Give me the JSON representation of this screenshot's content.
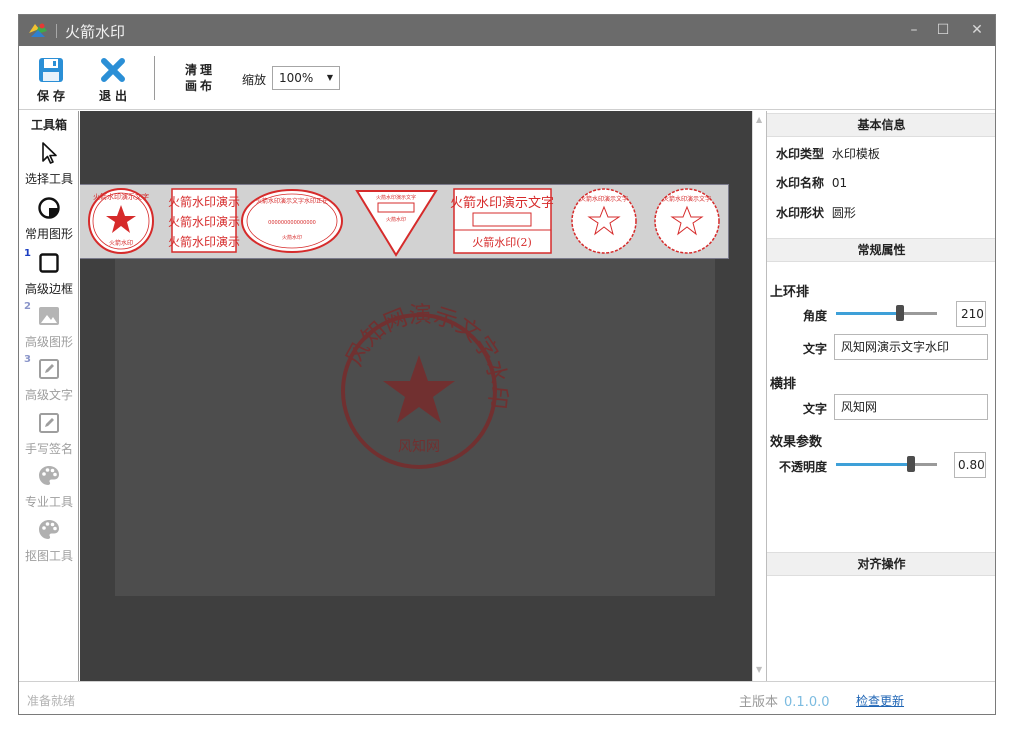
{
  "window": {
    "title": "火箭水印",
    "minimize": "–",
    "maximize": "☐",
    "close": "✕"
  },
  "toolbar": {
    "save_label": "保存",
    "exit_label": "退出",
    "clear_line1": "清理",
    "clear_line2": "画布",
    "zoom_label": "缩放",
    "zoom_value": "100%"
  },
  "toolbox": {
    "title": "工具箱",
    "items": [
      {
        "label": "选择工具",
        "icon": "cursor-icon",
        "num": "",
        "enabled": true
      },
      {
        "label": "常用图形",
        "icon": "shape-icon",
        "num": "",
        "enabled": true
      },
      {
        "label": "高级边框",
        "icon": "square-icon",
        "num": "1",
        "enabled": true
      },
      {
        "label": "高级图形",
        "icon": "image-icon",
        "num": "2",
        "enabled": false
      },
      {
        "label": "高级文字",
        "icon": "edit-icon",
        "num": "3",
        "enabled": false
      },
      {
        "label": "手写签名",
        "icon": "edit-icon",
        "num": "",
        "enabled": false
      },
      {
        "label": "专业工具",
        "icon": "palette-icon",
        "num": "",
        "enabled": false
      },
      {
        "label": "抠图工具",
        "icon": "palette-icon",
        "num": "",
        "enabled": false
      }
    ]
  },
  "templates": {
    "stamp_red": "#d62b2b",
    "t2_lines": [
      "火箭水印演示",
      "火箭水印演示",
      "火箭水印演示"
    ],
    "t5_top": "火箭水印演示文字",
    "t5_bottom": "火箭水印(2)",
    "t1_text": "火箭水印演示文字",
    "t1_bottom": "火箭水印",
    "t3_text": "火箭水印演示文字水印正在",
    "t3_mid": "000000000000000",
    "t3_bottom": "火箭水印",
    "t4_text": "火箭水印演示文字",
    "t4_bottom": "火箭水印",
    "t6_text": "火箭水印演示文字",
    "t7_text": "火箭水印演示文字"
  },
  "stamp": {
    "ring_text": "风知网演示文字水印",
    "center_text": "风知网",
    "color": "#7a2a2a"
  },
  "props": {
    "basic_title": "基本信息",
    "type_label": "水印类型",
    "type_value": "水印模板",
    "name_label": "水印名称",
    "name_value": "01",
    "shape_label": "水印形状",
    "shape_value": "圆形",
    "general_title": "常规属性",
    "ring_group": "上环排",
    "angle_label": "角度",
    "angle_value": "210",
    "ring_text_label": "文字",
    "ring_text_value": "风知网演示文字水印",
    "horiz_group": "横排",
    "horiz_text_label": "文字",
    "horiz_text_value": "风知网",
    "effect_group": "效果参数",
    "opacity_label": "不透明度",
    "opacity_value": "0.80",
    "align_title": "对齐操作",
    "angle_fraction": 0.6,
    "opacity_fraction": 0.8
  },
  "status": {
    "ready": "准备就绪",
    "version_label": "主版本",
    "version_value": "0.1.0.0",
    "update_link": "检查更新"
  }
}
